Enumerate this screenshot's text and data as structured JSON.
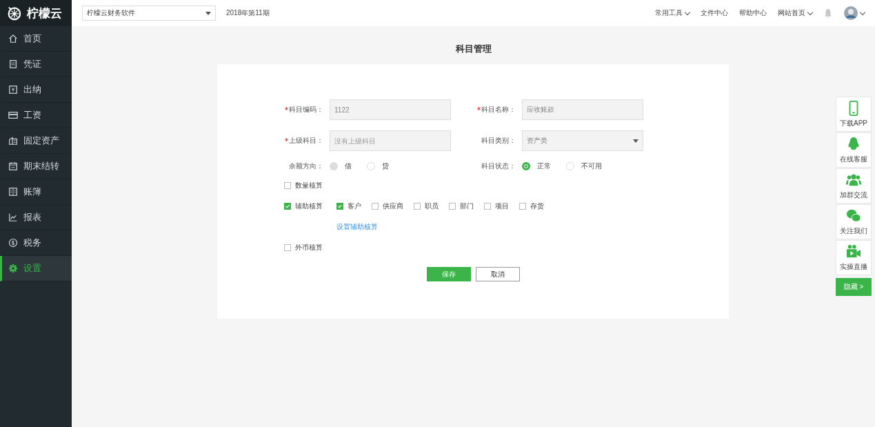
{
  "logo": {
    "text": "柠檬云"
  },
  "header": {
    "account_select": "柠檬云财务软件",
    "period": "2018年第11期",
    "links": [
      {
        "label": "常用工具",
        "dropdown": true
      },
      {
        "label": "文件中心",
        "dropdown": false
      },
      {
        "label": "帮助中心",
        "dropdown": false
      },
      {
        "label": "网站首页",
        "dropdown": true
      }
    ]
  },
  "sidebar": {
    "items": [
      {
        "label": "首页",
        "selected": false
      },
      {
        "label": "凭证",
        "selected": false
      },
      {
        "label": "出纳",
        "selected": false
      },
      {
        "label": "工资",
        "selected": false
      },
      {
        "label": "固定资产",
        "selected": false
      },
      {
        "label": "期末结转",
        "selected": false
      },
      {
        "label": "账簿",
        "selected": false
      },
      {
        "label": "报表",
        "selected": false
      },
      {
        "label": "税务",
        "selected": false
      },
      {
        "label": "设置",
        "selected": true
      }
    ]
  },
  "page_title": "科目管理",
  "form": {
    "fields": [
      {
        "label": "科目编码：",
        "required": true,
        "kind": "input",
        "value": "1122"
      },
      {
        "label": "科目名称：",
        "required": true,
        "kind": "input",
        "value": "应收账款"
      },
      {
        "label": "上级科目：",
        "required": true,
        "kind": "input",
        "placeholder": "没有上级科目"
      },
      {
        "label": "科目类别：",
        "required": false,
        "kind": "select",
        "value": "资产类"
      }
    ],
    "radio_groups": [
      {
        "label": "余额方向：",
        "disabled": true,
        "options": [
          {
            "label": "借",
            "selected": true
          },
          {
            "label": "贷",
            "selected": false
          }
        ]
      },
      {
        "label": "科目状态：",
        "disabled": false,
        "options": [
          {
            "label": "正常",
            "selected": true
          },
          {
            "label": "不可用",
            "selected": false
          }
        ]
      }
    ],
    "quantity": {
      "label": "数量核算",
      "checked": false
    },
    "auxiliary": {
      "label": "辅助核算",
      "checked": true,
      "options": [
        {
          "label": "客户",
          "checked": true
        },
        {
          "label": "供应商",
          "checked": false
        },
        {
          "label": "职员",
          "checked": false
        },
        {
          "label": "部门",
          "checked": false
        },
        {
          "label": "项目",
          "checked": false
        },
        {
          "label": "存货",
          "checked": false
        }
      ],
      "link": "设置辅助核算"
    },
    "foreign": {
      "label": "外币核算",
      "checked": false
    },
    "buttons": [
      {
        "label": "保存",
        "kind": "primary"
      },
      {
        "label": "取消",
        "kind": "default"
      }
    ]
  },
  "float_panel": {
    "items": [
      {
        "label": "下载APP"
      },
      {
        "label": "在线客服"
      },
      {
        "label": "加群交流"
      },
      {
        "label": "关注我们"
      },
      {
        "label": "实操直播"
      }
    ],
    "hide_button": "隐藏 >"
  }
}
